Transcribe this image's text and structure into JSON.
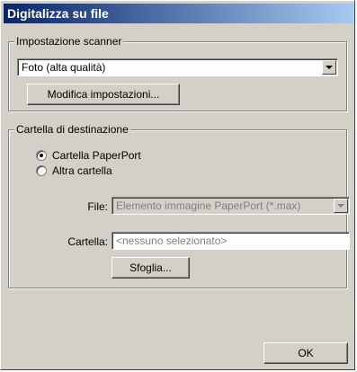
{
  "window": {
    "title": "Digitalizza su file"
  },
  "scanner_group": {
    "label": "Impostazione scanner",
    "selected_option": "Foto (alta qualità)",
    "modify_button": "Modifica impostazioni..."
  },
  "destination_group": {
    "label": "Cartella di destinazione",
    "radio_options": [
      {
        "label": "Cartella PaperPort",
        "selected": true
      },
      {
        "label": "Altra cartella",
        "selected": false
      }
    ],
    "file_label": "File:",
    "file_value": "Elemento immagine PaperPort (*.max)",
    "folder_label": "Cartella:",
    "folder_placeholder": "<nessuno selezionato>",
    "browse_button": "Sfoglia..."
  },
  "footer": {
    "ok_button": "OK"
  },
  "icons": [
    "combo-dropdown-arrow-icon",
    "radio-selected-icon",
    "radio-unselected-icon"
  ]
}
